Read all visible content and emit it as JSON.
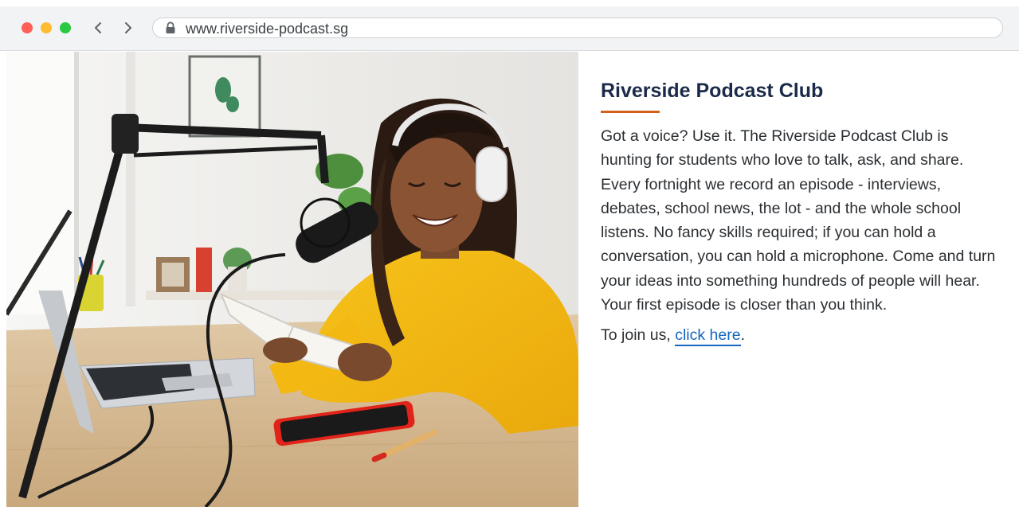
{
  "browser": {
    "url": "www.riverside-podcast.sg",
    "colors": {
      "close": "#fe5f57",
      "minimize": "#febc2e",
      "zoom": "#28c840"
    },
    "icons": {
      "back": "chevron-left-icon",
      "forward": "chevron-right-icon",
      "lock": "lock-icon"
    }
  },
  "article": {
    "title": "Riverside Podcast Club",
    "body": "Got a voice? Use it. The Riverside Podcast Club is hunting for students who love to talk, ask, and share. Every fortnight we record an episode - interviews, debates, school news, the lot - and the whole school listens. No fancy skills required; if you can hold a conversation, you can hold a microphone. Come and turn your ideas into something hundreds of people will hear. Your first episode is closer than you think.",
    "join_prefix": "To join us, ",
    "join_link": "click here",
    "join_suffix": ".",
    "colors": {
      "title": "#1b2a4a",
      "accent_rule": "#d4611a",
      "link": "#1565c0"
    }
  }
}
